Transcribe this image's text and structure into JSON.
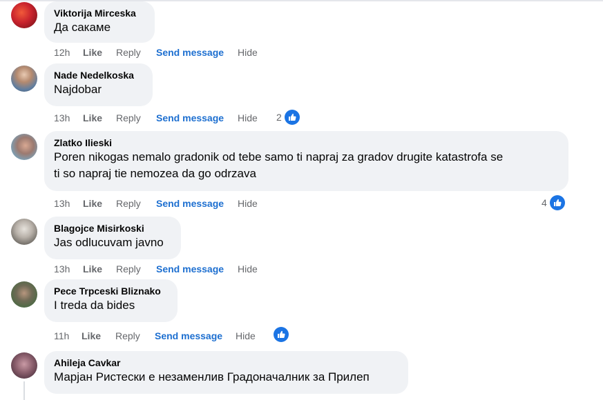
{
  "comments": [
    {
      "author": "Viktorija Mirceska",
      "text": "Да сакаме",
      "time": "12h",
      "like": "Like",
      "reply": "Reply",
      "send_message": "Send message",
      "hide": "Hide",
      "reaction_count": ""
    },
    {
      "author": "Nade Nedelkoska",
      "text": "Najdobar",
      "time": "13h",
      "like": "Like",
      "reply": "Reply",
      "send_message": "Send message",
      "hide": "Hide",
      "reaction_count": "2"
    },
    {
      "author": "Zlatko Ilieski",
      "text": "Poren nikogas nemalo gradonik od tebe samo ti napraj za gradov drugite katastrofa se\nti so napraj tie nemozea da go odrzava",
      "time": "13h",
      "like": "Like",
      "reply": "Reply",
      "send_message": "Send message",
      "hide": "Hide",
      "reaction_count": "4"
    },
    {
      "author": "Blagojce Misirkoski",
      "text": "Jas odlucuvam javno",
      "time": "13h",
      "like": "Like",
      "reply": "Reply",
      "send_message": "Send message",
      "hide": "Hide",
      "reaction_count": ""
    },
    {
      "author": "Pece Trpceski Bliznako",
      "text": "I treda da bides",
      "time": "11h",
      "like": "Like",
      "reply": "Reply",
      "send_message": "Send message",
      "hide": "Hide",
      "reaction_count": ""
    },
    {
      "author": "Ahileja Cavkar",
      "text": "Марјан Ристески е незаменлив Градоначалник за Прилеп",
      "time": "",
      "like": "",
      "reply": "",
      "send_message": "",
      "hide": "",
      "reaction_count": ""
    }
  ],
  "colors": {
    "bubble": "#f0f2f5",
    "link_blue": "#1d6fd0",
    "like_blue": "#1b74e4",
    "meta_gray": "#65676b"
  },
  "icons": {
    "reaction": "like-thumb-icon"
  }
}
